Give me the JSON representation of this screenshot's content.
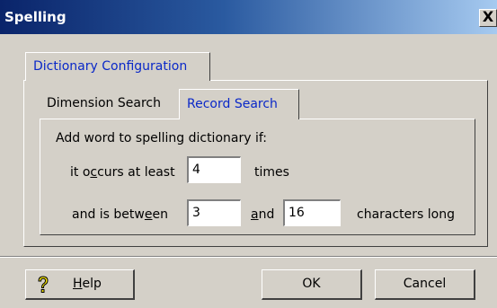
{
  "window": {
    "title": "Spelling",
    "close_glyph": "X"
  },
  "outer_tab": {
    "label": "Dictionary Configuration"
  },
  "inner_tabs": [
    {
      "label": "Dimension Search"
    },
    {
      "label": "Record Search"
    }
  ],
  "record_search": {
    "heading": "Add word to spelling dictionary if:",
    "occurs_prefix": "it o",
    "occurs_access": "c",
    "occurs_suffix": "curs at least",
    "occurs_value": "4",
    "times_label": "times",
    "between_prefix": "and is betw",
    "between_access": "e",
    "between_suffix": "en",
    "min_value": "3",
    "and_access": "a",
    "and_suffix": "nd",
    "max_value": "16",
    "chars_label": "characters long"
  },
  "buttons": {
    "help_access": "H",
    "help_suffix": "elp",
    "ok": "OK",
    "cancel": "Cancel"
  },
  "icons": {
    "help": "question-mark-icon",
    "close": "close-icon"
  },
  "colors": {
    "title_start": "#0a246a",
    "title_end": "#a6caf0",
    "tab_active_text": "#0a28c8",
    "dialog_bg": "#d4d0c8"
  }
}
